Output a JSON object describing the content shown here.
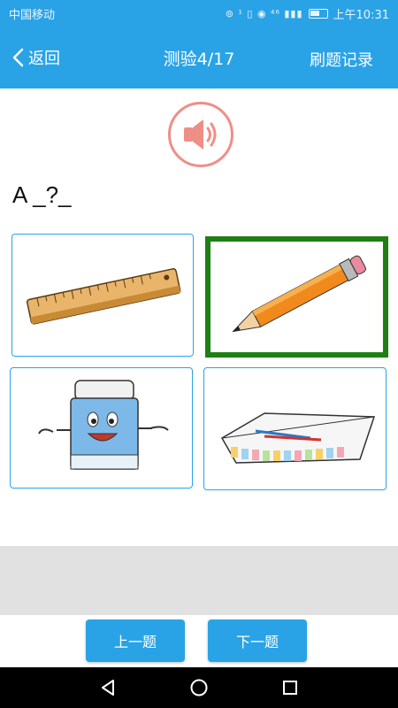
{
  "status": {
    "carrier": "中国移动",
    "time": "上午10:31",
    "signal_icons": "⊚ ¹ ▯ ◉ ⁴⁶ ▮▮▮"
  },
  "header": {
    "back_label": "返回",
    "title": "测验4/17",
    "history_label": "刷题记录"
  },
  "question": {
    "text": "A _?_"
  },
  "options": [
    {
      "icon": "ruler",
      "selected": false
    },
    {
      "icon": "pencil",
      "selected": true
    },
    {
      "icon": "eraser-character",
      "selected": false
    },
    {
      "icon": "pencil-case",
      "selected": false
    }
  ],
  "footer": {
    "prev_label": "上一题",
    "next_label": "下一题"
  },
  "colors": {
    "accent": "#2aa3e6",
    "selected_border": "#1e7f14",
    "speaker": "#ee8f86"
  }
}
